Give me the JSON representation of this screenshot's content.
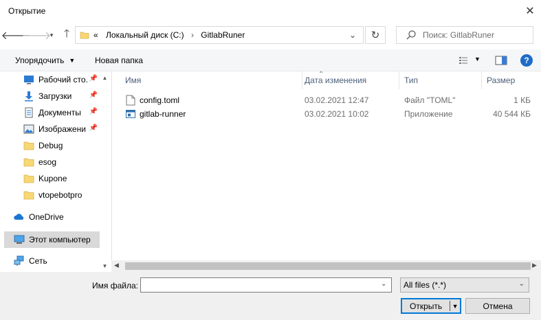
{
  "window": {
    "title": "Открытие"
  },
  "address": {
    "crumbs": [
      "«",
      "Локальный диск (C:)",
      "GitlabRuner"
    ],
    "search_placeholder": "Поиск: GitlabRuner"
  },
  "toolbar": {
    "organize": "Упорядочить",
    "new_folder": "Новая папка"
  },
  "nav": {
    "items": [
      {
        "label": "Рабочий сто.",
        "icon": "desktop-icon",
        "pinned": true
      },
      {
        "label": "Загрузки",
        "icon": "download-arrow-icon",
        "pinned": true
      },
      {
        "label": "Документы",
        "icon": "documents-icon",
        "pinned": true
      },
      {
        "label": "Изображени",
        "icon": "pictures-icon",
        "pinned": true
      },
      {
        "label": "Debug",
        "icon": "folder-icon",
        "pinned": false
      },
      {
        "label": "esog",
        "icon": "folder-icon",
        "pinned": false
      },
      {
        "label": "Kupone",
        "icon": "folder-icon",
        "pinned": false
      },
      {
        "label": "vtopebotpro",
        "icon": "folder-icon",
        "pinned": false
      },
      {
        "label": "OneDrive",
        "icon": "onedrive-cloud-icon",
        "pinned": false
      },
      {
        "label": "Этот компьютер",
        "icon": "computer-icon",
        "pinned": false,
        "selected": true
      },
      {
        "label": "Сеть",
        "icon": "network-icon",
        "pinned": false
      }
    ]
  },
  "columns": {
    "name": "Имя",
    "date": "Дата изменения",
    "type": "Тип",
    "size": "Размер"
  },
  "files": [
    {
      "name": "config.toml",
      "date": "03.02.2021 12:47",
      "type": "Файл \"TOML\"",
      "size": "1 КБ",
      "icon": "text-file-icon"
    },
    {
      "name": "gitlab-runner",
      "date": "03.02.2021 10:02",
      "type": "Приложение",
      "size": "40 544 КБ",
      "icon": "application-icon"
    }
  ],
  "footer": {
    "filename_label": "Имя файла:",
    "filename_value": "",
    "filter_value": "All files (*.*)",
    "open_label": "Открыть",
    "cancel_label": "Отмена"
  },
  "colors": {
    "accent": "#0078d7",
    "help": "#1e6bc8",
    "folder": "#f8d775",
    "header_text": "#4c607a"
  }
}
